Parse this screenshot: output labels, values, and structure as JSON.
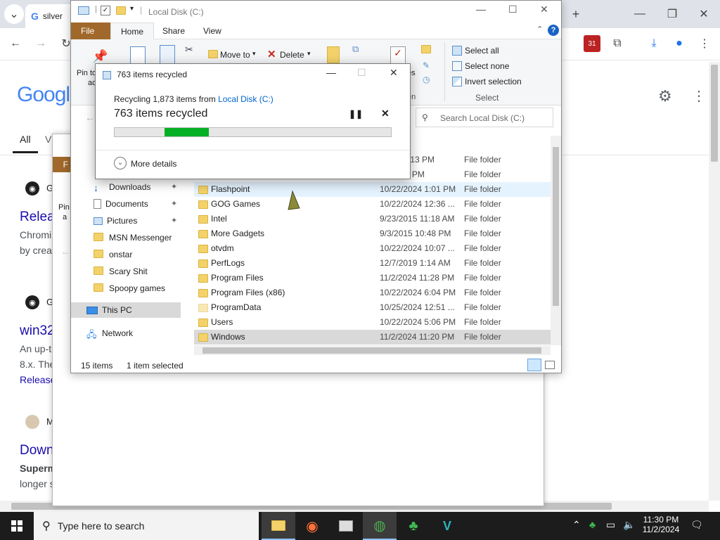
{
  "chrome": {
    "tab_title": "silver",
    "google_logo": "Googl",
    "tab_all": "All",
    "tab_v": "V",
    "results": [
      {
        "site_icon": "github-icon",
        "site": "G",
        "title": "Relea",
        "snippet1": "Chromi",
        "snippet2": "by creat"
      },
      {
        "site_icon": "github-icon",
        "site": "G",
        "title": "win32",
        "snippet1": "An up-t",
        "snippet2": "8.x. The",
        "extra": "Release"
      },
      {
        "site_icon": "avatar-icon",
        "site": "M",
        "title": "Down",
        "snippet1": "Superm",
        "snippet2": "longer s"
      }
    ],
    "new_tab": "+"
  },
  "explorer": {
    "title": "Local Disk (C:)",
    "ribbon_tabs": [
      "File",
      "Home",
      "Share",
      "View"
    ],
    "ribbon": {
      "pin_label": "Pin to",
      "pin_label2": "ac",
      "move_to": "Move to",
      "delete": "Delete",
      "select_all": "Select all",
      "select_none": "Select none",
      "invert_selection": "Invert selection",
      "select_group": "Select",
      "open_group": "en",
      "properties_partial": "es"
    },
    "search_placeholder": "Search Local Disk (C:)",
    "columns": {
      "modified": "dified",
      "type": "Type"
    },
    "nav": [
      {
        "label": "Downloads",
        "icon": "download-icon",
        "pinned": true
      },
      {
        "label": "Documents",
        "icon": "documents-icon",
        "pinned": true
      },
      {
        "label": "Pictures",
        "icon": "pictures-icon",
        "pinned": true
      },
      {
        "label": "MSN Messenger",
        "icon": "folder-icon",
        "pinned": false
      },
      {
        "label": "onstar",
        "icon": "folder-icon",
        "pinned": false
      },
      {
        "label": "Scary Shit",
        "icon": "folder-icon",
        "pinned": false
      },
      {
        "label": "Spoopy games",
        "icon": "folder-icon",
        "pinned": false
      },
      {
        "label": "This PC",
        "icon": "computer-icon",
        "pinned": false
      },
      {
        "label": "Network",
        "icon": "network-icon",
        "pinned": false
      }
    ],
    "files": [
      {
        "name": "",
        "date": "/2024 5:13 PM",
        "type": "File folder"
      },
      {
        "name": "",
        "date": "/4 11:09 PM",
        "type": "File folder"
      },
      {
        "name": "Flashpoint",
        "date": "10/22/2024 1:01 PM",
        "type": "File folder"
      },
      {
        "name": "GOG Games",
        "date": "10/22/2024 12:36 ...",
        "type": "File folder"
      },
      {
        "name": "Intel",
        "date": "9/23/2015 11:18 AM",
        "type": "File folder"
      },
      {
        "name": "More Gadgets",
        "date": "9/3/2015 10:48 PM",
        "type": "File folder"
      },
      {
        "name": "otvdm",
        "date": "10/22/2024 10:07 ...",
        "type": "File folder"
      },
      {
        "name": "PerfLogs",
        "date": "12/7/2019 1:14 AM",
        "type": "File folder"
      },
      {
        "name": "Program Files",
        "date": "11/2/2024 11:28 PM",
        "type": "File folder"
      },
      {
        "name": "Program Files (x86)",
        "date": "10/22/2024 6:04 PM",
        "type": "File folder"
      },
      {
        "name": "ProgramData",
        "date": "10/25/2024 12:51 ...",
        "type": "File folder"
      },
      {
        "name": "Users",
        "date": "10/22/2024 5:06 PM",
        "type": "File folder"
      },
      {
        "name": "Windows",
        "date": "11/2/2024 11:20 PM",
        "type": "File folder"
      }
    ],
    "status_count": "15 items",
    "status_selected": "1 item selected",
    "back_window_partial": {
      "tab": "F",
      "pin": "Pin",
      "pin2": "a"
    }
  },
  "dialog": {
    "title": "763 items recycled",
    "line1_prefix": "Recycling 1,873 items from ",
    "line1_link": "Local Disk (C:)",
    "headline": "763 items recycled",
    "progress": 0.34,
    "progress_start": 0.18,
    "more_details": "More details"
  },
  "taskbar": {
    "search_placeholder": "Type here to search",
    "time": "11:30 PM",
    "date": "11/2/2024"
  },
  "colors": {
    "file_tab": "#a0692b",
    "progress": "#06b025",
    "link": "#0066cc",
    "selection": "#cce8ff",
    "taskbar": "#1c1c1c"
  }
}
